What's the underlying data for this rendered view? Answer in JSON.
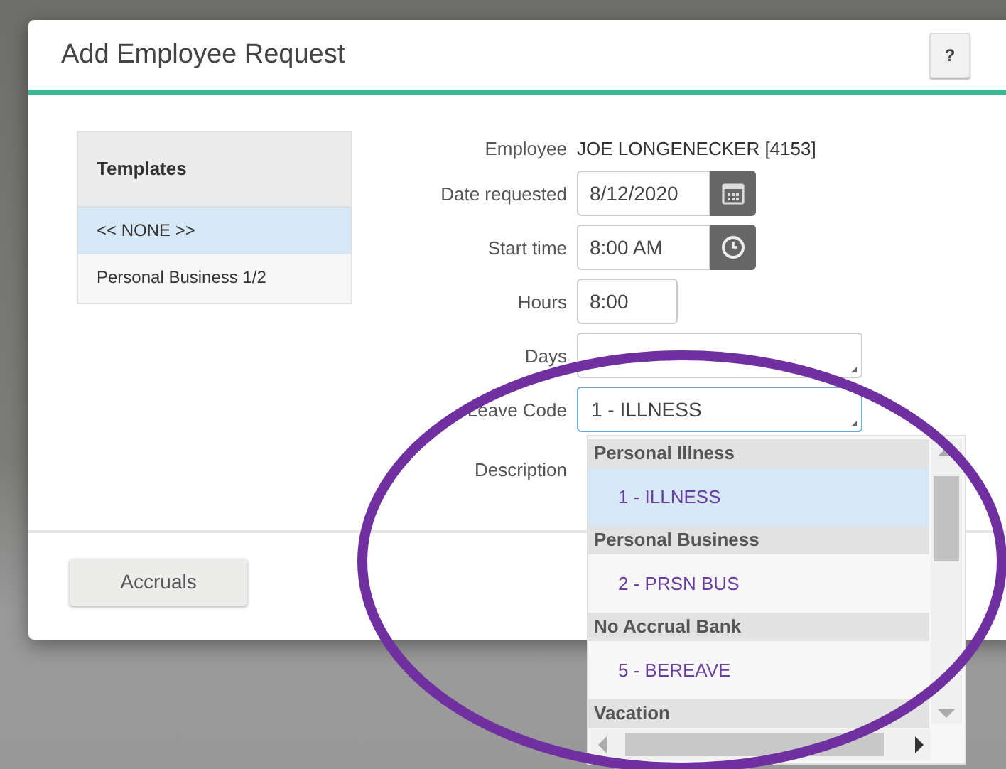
{
  "dialog": {
    "title": "Add Employee Request",
    "help_button": "?"
  },
  "templates": {
    "heading": "Templates",
    "items": [
      {
        "label": "<< NONE >>",
        "selected": true
      },
      {
        "label": "Personal Business 1/2",
        "selected": false
      }
    ]
  },
  "form": {
    "fields": [
      {
        "kind": "text",
        "label": "Employee",
        "value": "JOE LONGENECKER [4153]"
      },
      {
        "kind": "date",
        "label": "Date requested",
        "value": "8/12/2020"
      },
      {
        "kind": "time",
        "label": "Start time",
        "value": "8:00 AM"
      },
      {
        "kind": "input",
        "label": "Hours",
        "value": "8:00"
      },
      {
        "kind": "select",
        "label": "Days",
        "focused": false
      },
      {
        "kind": "select",
        "label": "Leave Code",
        "value": "1 - ILLNESS",
        "focused": true
      },
      {
        "kind": "textarea",
        "label": "Description"
      }
    ]
  },
  "leave_code_list": {
    "groups": [
      {
        "name": "Personal Illness",
        "options": [
          {
            "label": "1 - ILLNESS",
            "selected": true
          }
        ]
      },
      {
        "name": "Personal Business",
        "options": [
          {
            "label": "2 - PRSN BUS",
            "selected": false
          }
        ]
      },
      {
        "name": "No Accrual Bank",
        "options": [
          {
            "label": "5 - BEREAVE",
            "selected": false
          }
        ]
      },
      {
        "name": "Vacation"
      }
    ]
  },
  "footer": {
    "buttons": [
      "Accruals"
    ]
  }
}
